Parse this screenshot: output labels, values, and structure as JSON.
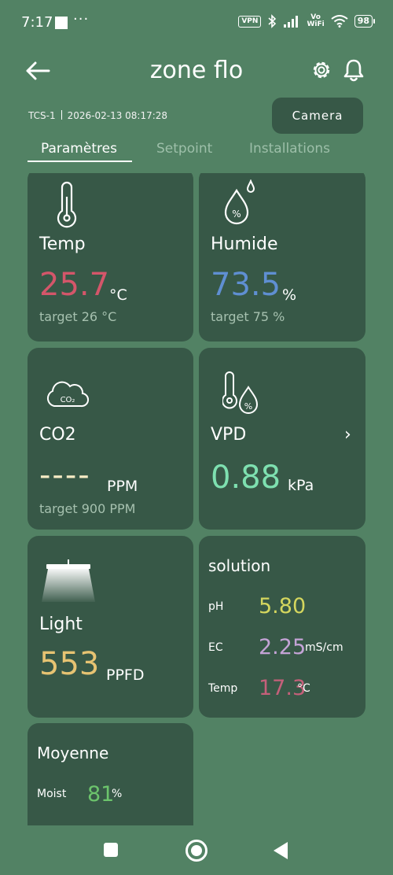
{
  "status_bar": {
    "time": "7:17",
    "more": "···",
    "vpn": "VPN",
    "vowifi_line1": "Vo",
    "vowifi_line2": "WiFi",
    "battery": "98"
  },
  "header": {
    "title": "zone flo",
    "icons": [
      "back-arrow-icon",
      "gear-icon",
      "bell-icon"
    ]
  },
  "info": {
    "device_id": "TCS-1",
    "timestamp": "2026-02-13 08:17:28"
  },
  "camera_button": "Camera",
  "tabs": [
    {
      "label": "Paramètres",
      "active": true
    },
    {
      "label": "Setpoint",
      "active": false
    },
    {
      "label": "Installations",
      "active": false
    }
  ],
  "cards": {
    "temp": {
      "label": "Temp",
      "value": "25.7",
      "unit": "°C",
      "target": "target 26 °C",
      "color": "#d4566a"
    },
    "humidity": {
      "label": "Humide",
      "value": "73.5",
      "unit": "%",
      "target": "target 75 %",
      "color": "#5f8fd2"
    },
    "co2": {
      "label": "CO2",
      "value": "----",
      "unit": "PPM",
      "target": "target 900 PPM",
      "color": "#f7ecc6",
      "icon_text": "CO₂"
    },
    "vpd": {
      "label": "VPD",
      "value": "0.88",
      "unit": "kPa",
      "chevron": "›",
      "color": "#7ee0b0"
    },
    "light": {
      "label": "Light",
      "value": "553",
      "unit": "PPFD",
      "color": "#e6c372"
    },
    "solution": {
      "title": "solution",
      "rows": [
        {
          "label": "pH",
          "value": "5.80",
          "unit": "",
          "color": "#d4d65e"
        },
        {
          "label": "EC",
          "value": "2.25",
          "unit": "mS/cm",
          "color": "#c4a3d6"
        },
        {
          "label": "Temp",
          "value": "17.3",
          "unit": "°C",
          "color": "#c4607a"
        }
      ]
    },
    "moyenne": {
      "title": "Moyenne",
      "label": "Moist",
      "value": "81",
      "unit": "%",
      "color": "#6cc46c"
    }
  }
}
